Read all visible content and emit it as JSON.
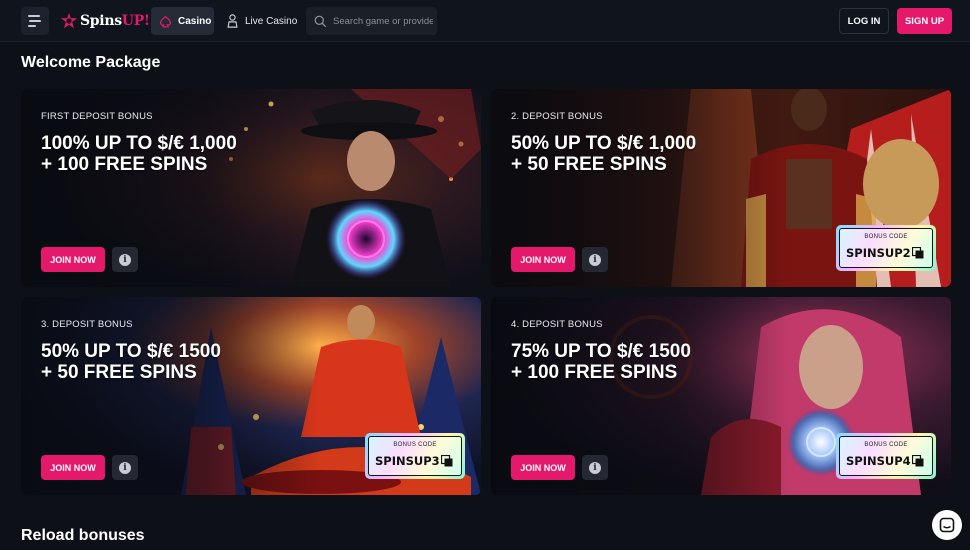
{
  "header": {
    "logo_prefix": "Spins",
    "logo_suffix": "UP!",
    "nav_casino": "Casino",
    "nav_live_casino": "Live Casino",
    "search_placeholder": "Search game or provider",
    "login_label": "LOG IN",
    "signup_label": "SIGN UP"
  },
  "welcome": {
    "title": "Welcome Package",
    "cards": [
      {
        "label": "FIRST DEPOSIT BONUS",
        "line1": "100% UP TO $/€ 1,000",
        "line2": "+ 100 FREE SPINS",
        "join": "JOIN NOW",
        "code_title": "",
        "code": ""
      },
      {
        "label": "2. DEPOSIT BONUS",
        "line1": "50% UP TO $/€ 1,000",
        "line2": "+ 50 FREE SPINS",
        "join": "JOIN NOW",
        "code_title": "BONUS CODE",
        "code": "SPINSUP2"
      },
      {
        "label": "3. DEPOSIT BONUS",
        "line1": "50% UP TO $/€ 1500",
        "line2": "+ 50 FREE SPINS",
        "join": "JOIN NOW",
        "code_title": "BONUS CODE",
        "code": "SPINSUP3"
      },
      {
        "label": "4. DEPOSIT BONUS",
        "line1": "75% UP TO $/€ 1500",
        "line2": "+ 100 FREE SPINS",
        "join": "JOIN NOW",
        "code_title": "BONUS CODE",
        "code": "SPINSUP4"
      }
    ]
  },
  "reload": {
    "title": "Reload bonuses"
  },
  "colors": {
    "accent": "#e5196b",
    "background": "#0d1017",
    "header": "#10141c"
  },
  "icons": [
    "menu-icon",
    "casino-icon",
    "live-casino-icon",
    "search-icon",
    "info-icon",
    "copy-icon",
    "chat-icon"
  ]
}
